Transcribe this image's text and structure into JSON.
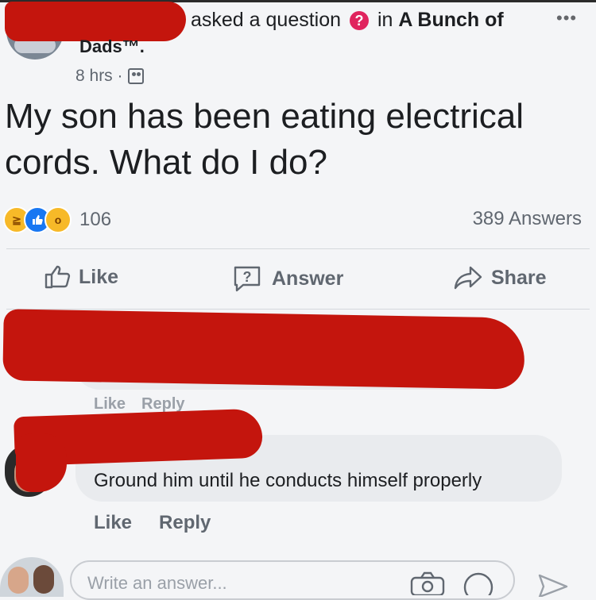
{
  "header": {
    "asked_text": "asked a question",
    "question_badge": "?",
    "in_text": "in",
    "group_name": "A Bunch of",
    "group_name_cont": "Dads™.",
    "time": "8 hrs ·",
    "more_icon": "more-icon"
  },
  "post": {
    "text": "My son has been eating electrical cords. What do I do?"
  },
  "stats": {
    "reaction_count": "106",
    "answers_count": "389 Answers",
    "reactions": [
      "haha",
      "like",
      "wow"
    ]
  },
  "actions": {
    "like": "Like",
    "answer": "Answer",
    "share": "Share"
  },
  "comment_hidden": {
    "like": "Like",
    "reply": "Reply"
  },
  "comment": {
    "text": "Ground him until he conducts himself properly",
    "like": "Like",
    "reply": "Reply"
  },
  "composer": {
    "placeholder": "Write an answer..."
  },
  "colors": {
    "redaction": "#c4150d",
    "badge": "#e0245e",
    "like_blue": "#1877f2",
    "reaction_yellow": "#f7b928"
  }
}
